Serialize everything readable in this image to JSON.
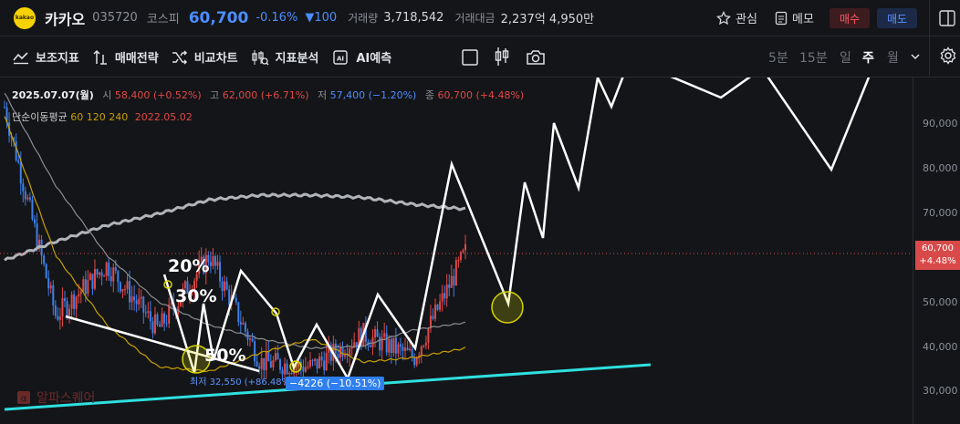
{
  "header": {
    "logo_text": "kakao",
    "name": "카카오",
    "code": "035720",
    "market": "코스피",
    "price": "60,700",
    "change_pct": "-0.16%",
    "change_val": "100",
    "volume_label": "거래량",
    "volume": "3,718,542",
    "amount_label": "거래대금",
    "amount": "2,237억 4,950만",
    "watch_label": "관심",
    "memo_label": "메모",
    "buy_label": "매수",
    "sell_label": "매도"
  },
  "toolbar": {
    "items": [
      "보조지표",
      "매매전략",
      "비교차트",
      "지표분석",
      "AI예측"
    ],
    "timeframes": [
      "5분",
      "15분",
      "일",
      "주",
      "월"
    ],
    "active_timeframe": "주"
  },
  "legend": {
    "date": "2025.07.07(월)",
    "open_label": "시",
    "open": "58,400 (+0.52%)",
    "high_label": "고",
    "high": "62,000 (+6.71%)",
    "low_label": "저",
    "low": "57,400 (−1.20%)",
    "close_label": "종",
    "close": "60,700 (+4.48%)",
    "ma_label": "단순이동평균",
    "ma_values": "60 120 240",
    "ma_date": "2022.05.02"
  },
  "price_axis": [
    "90,000",
    "80,000",
    "70,000",
    "60,000",
    "50,000",
    "40,000",
    "30,000"
  ],
  "current_tag": {
    "price": "60,700",
    "pct": "+4.48%"
  },
  "annotations": {
    "p20": "20%",
    "p30": "30%",
    "p50": "50%"
  },
  "low_label": "최저 32,550 (+86.48%)",
  "diff_label": "−4226 (−10.51%)",
  "watermark": "알파스퀘어",
  "colors": {
    "up": "#e04848",
    "down": "#3f7fe8",
    "accent": "#4c8dff",
    "ma60": "#c8a000",
    "ma120": "#8a8d92",
    "ma240": "#b0b3b8",
    "trend": "#2fe0e0"
  },
  "chart_data": {
    "type": "line",
    "title": "",
    "ylim": [
      27000,
      97000
    ],
    "series": [
      {
        "name": "60",
        "values": [
          90000,
          60000,
          45000,
          36000,
          35000,
          39000,
          42000,
          37000,
          38000,
          40000
        ]
      },
      {
        "name": "120",
        "values": [
          95000,
          75000,
          60000,
          50000,
          45000,
          42000,
          40000,
          40500,
          44000,
          45500
        ]
      },
      {
        "name": "240",
        "values": [
          59000,
          63000,
          66500,
          69000,
          72000,
          73000,
          73000,
          72500,
          71000,
          70000
        ]
      },
      {
        "name": "price",
        "values": [
          92000,
          47000,
          58000,
          44000,
          60000,
          37000,
          36000,
          43000,
          38000,
          60700
        ]
      }
    ]
  }
}
